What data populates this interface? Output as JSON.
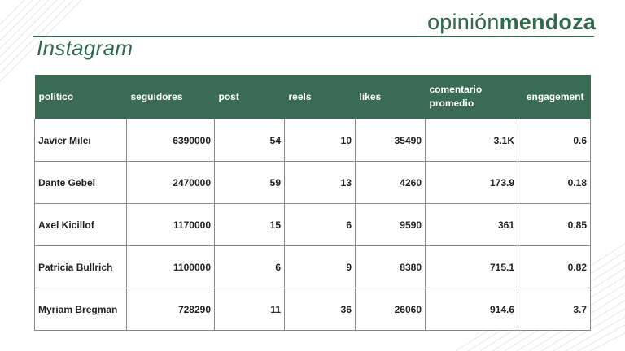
{
  "brand": {
    "part1": "opinión",
    "part2": "mendoza"
  },
  "page_title": "Instagram",
  "table": {
    "headers": [
      "político",
      "seguidores",
      "post",
      "reels",
      "likes",
      "comentario promedio",
      "engagement"
    ],
    "rows": [
      [
        "Javier Milei",
        "6390000",
        "54",
        "10",
        "35490",
        "3.1K",
        "0.6"
      ],
      [
        "Dante Gebel",
        "2470000",
        "59",
        "13",
        "4260",
        "173.9",
        "0.18"
      ],
      [
        "Axel Kicillof",
        "1170000",
        "15",
        "6",
        "9590",
        "361",
        "0.85"
      ],
      [
        "Patricia Bullrich",
        "1100000",
        "6",
        "9",
        "8380",
        "715.1",
        "0.82"
      ],
      [
        "Myriam Bregman",
        "728290",
        "11",
        "36",
        "26060",
        "914.6",
        "3.7"
      ]
    ]
  },
  "colors": {
    "brand_green": "#2e6b4d",
    "header_bg": "#3a6b53",
    "border": "#8a8a8a"
  }
}
